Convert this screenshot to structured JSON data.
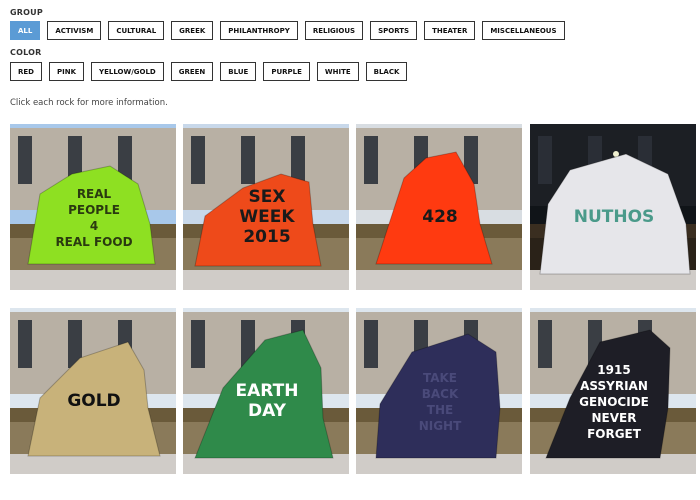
{
  "group": {
    "label": "GROUP",
    "options": [
      "ALL",
      "ACTIVISM",
      "CULTURAL",
      "GREEK",
      "PHILANTHROPY",
      "RELIGIOUS",
      "SPORTS",
      "THEATER",
      "MISCELLANEOUS"
    ],
    "selected": "ALL"
  },
  "color": {
    "label": "COLOR",
    "options": [
      "RED",
      "PINK",
      "YELLOW/GOLD",
      "GREEN",
      "BLUE",
      "PURPLE",
      "WHITE",
      "BLACK"
    ]
  },
  "instructions": "Click each rock for more information.",
  "accent_color": "#5b9bd5",
  "rocks": [
    {
      "rock_color": "#8ee022",
      "sky": "#a8c8ea",
      "lines": [
        "REAL",
        "PEOPLE",
        "4",
        "REAL FOOD"
      ],
      "text_color": "#2a3a10",
      "night": false
    },
    {
      "rock_color": "#ee4a1a",
      "sky": "#c8d8ea",
      "lines": [
        "SEX",
        "WEEK",
        "2015"
      ],
      "text_color": "#1a1a1a",
      "night": false
    },
    {
      "rock_color": "#ff3a10",
      "sky": "#d8dde2",
      "lines": [
        "428"
      ],
      "text_color": "#1a1a1a",
      "night": false
    },
    {
      "rock_color": "#e6e6ea",
      "sky": "#101418",
      "lines": [
        "NUTHOS"
      ],
      "text_color": "#4a9a8a",
      "night": true
    },
    {
      "rock_color": "#c8b27a",
      "sky": "#dde6ee",
      "lines": [
        "GOLD"
      ],
      "text_color": "#111111",
      "night": false
    },
    {
      "rock_color": "#2f8a4a",
      "sky": "#dde6ee",
      "lines": [
        "EARTH",
        "DAY"
      ],
      "text_color": "#ffffff",
      "night": false
    },
    {
      "rock_color": "#2e2e5a",
      "sky": "#dde6ee",
      "lines": [
        "TAKE",
        "BACK",
        "THE",
        "NIGHT"
      ],
      "text_color": "#4a4a7a",
      "night": false
    },
    {
      "rock_color": "#1e1e26",
      "sky": "#dde6ee",
      "lines": [
        "1915",
        "ASSYRIAN",
        "GENOCIDE",
        "NEVER",
        "FORGET"
      ],
      "text_color": "#ffffff",
      "night": false
    }
  ]
}
